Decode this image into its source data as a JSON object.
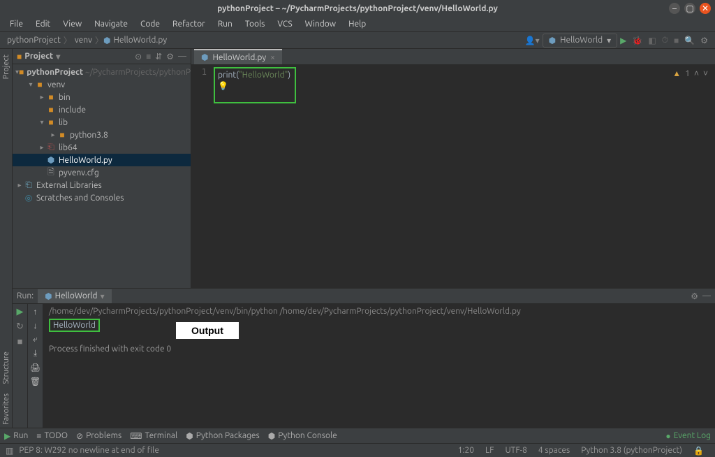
{
  "window": {
    "title": "pythonProject – ~/PycharmProjects/pythonProject/venv/HelloWorld.py"
  },
  "menu": [
    "File",
    "Edit",
    "View",
    "Navigate",
    "Code",
    "Refactor",
    "Run",
    "Tools",
    "VCS",
    "Window",
    "Help"
  ],
  "breadcrumb": [
    "pythonProject",
    "venv",
    "HelloWorld.py"
  ],
  "run_config": "HelloWorld",
  "project": {
    "pane_title": "Project",
    "root": "pythonProject",
    "root_path": "~/PycharmProjects/pythonPr",
    "venv": "venv",
    "bin": "bin",
    "include": "include",
    "lib": "lib",
    "py38": "python3.8",
    "lib64": "lib64",
    "hello": "HelloWorld.py",
    "pyvenv": "pyvenv.cfg",
    "extlib": "External Libraries",
    "scratches": "Scratches and Consoles"
  },
  "editor": {
    "tab": "HelloWorld.py",
    "line": "1",
    "code_fn": "print",
    "code_str": "\"HelloWorld\"",
    "warn_count": "1"
  },
  "run": {
    "label": "Run:",
    "tab": "HelloWorld",
    "command": "/home/dev/PycharmProjects/pythonProject/venv/bin/python /home/dev/PycharmProjects/pythonProject/venv/HelloWorld.py",
    "output": "HelloWorld",
    "exit": "Process finished with exit code 0",
    "annotation": "Output"
  },
  "bottom": {
    "run": "Run",
    "todo": "TODO",
    "problems": "Problems",
    "terminal": "Terminal",
    "packages": "Python Packages",
    "console": "Python Console",
    "eventlog": "Event Log"
  },
  "status": {
    "pep8": "PEP 8: W292 no newline at end of file",
    "pos": "1:20",
    "lf": "LF",
    "enc": "UTF-8",
    "indent": "4 spaces",
    "interp": "Python 3.8 (pythonProject)"
  },
  "leftgutter": {
    "project": "Project",
    "structure": "Structure",
    "favorites": "Favorites"
  }
}
